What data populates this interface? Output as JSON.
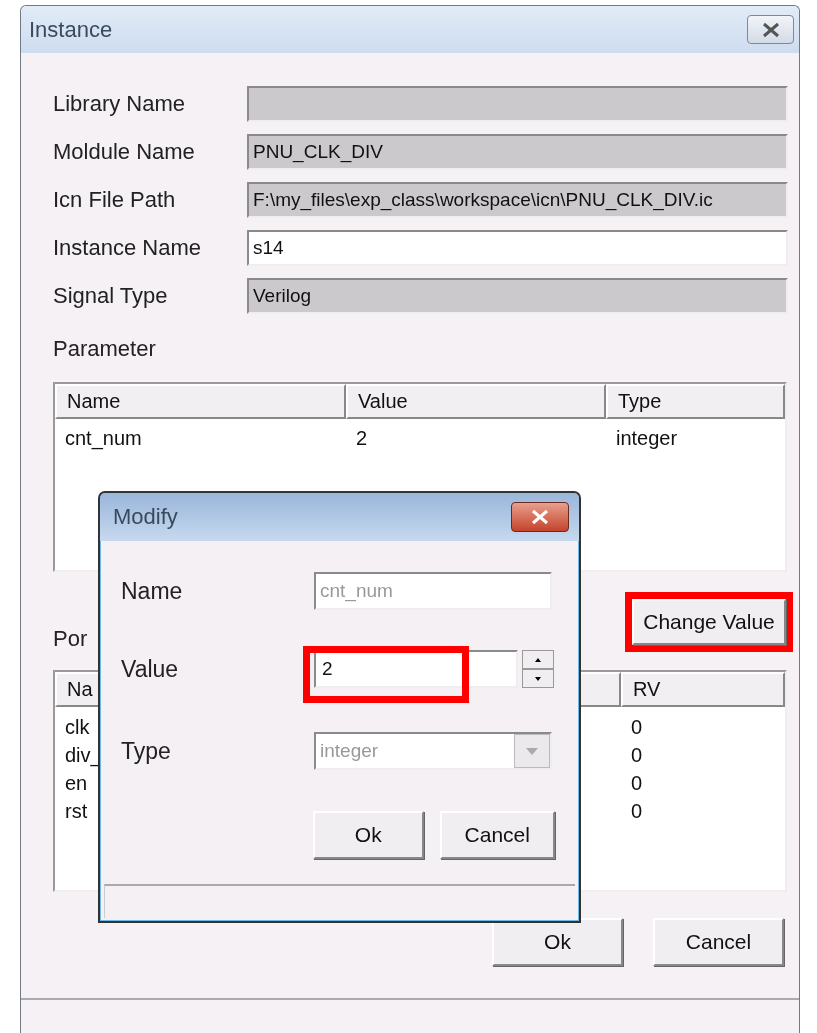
{
  "window": {
    "title": "Instance"
  },
  "fields": [
    {
      "label": "Library Name",
      "editable": false
    },
    {
      "label": "Moldule Name",
      "value": "PNU_CLK_DIV",
      "editable": false
    },
    {
      "label": "Icn File Path",
      "value": "F:\\my_files\\exp_class\\workspace\\icn\\PNU_CLK_DIV.ic",
      "editable": false
    },
    {
      "label": "Instance Name",
      "value": "s14",
      "editable": true
    },
    {
      "label": "Signal Type",
      "value": "Verilog",
      "editable": false
    }
  ],
  "parameter": {
    "label": "Parameter",
    "columns": [
      "Name",
      "Value",
      "Type"
    ],
    "rows": [
      [
        "cnt_num",
        "2",
        "integer"
      ]
    ]
  },
  "change_button": {
    "label": "Change Value",
    "highlighted": true
  },
  "port": {
    "label": "Por",
    "columns": [
      "Na",
      "RV"
    ],
    "rows": [
      [
        "clk",
        "0"
      ],
      [
        "div_",
        "0"
      ],
      [
        "en",
        "0"
      ],
      [
        "rst",
        "0"
      ]
    ]
  },
  "buttons": [
    "Ok",
    "Cancel"
  ],
  "modify_dialog": {
    "title": "Modify",
    "name": {
      "label": "Name",
      "value": "cnt_num",
      "disabled": true
    },
    "value": {
      "label": "Value",
      "value": "2",
      "highlighted": true
    },
    "type": {
      "label": "Type",
      "value": "integer",
      "disabled": true
    },
    "buttons": [
      "Ok",
      "Cancel"
    ]
  }
}
